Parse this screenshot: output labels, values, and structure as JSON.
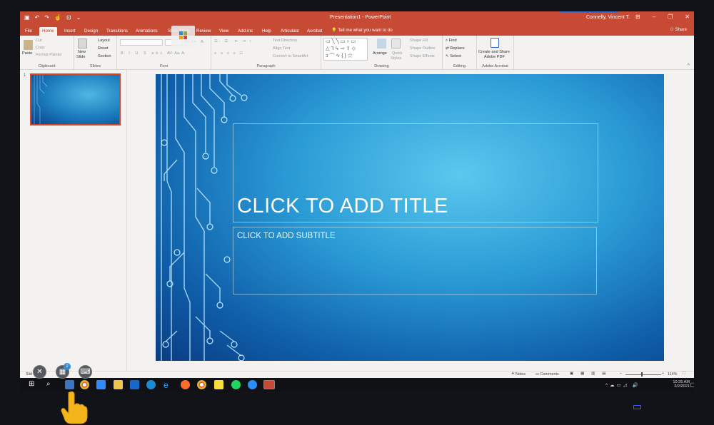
{
  "titlebar": {
    "document_title": "Presentation1 - PowerPoint",
    "user": "Connelly, Vincent T.",
    "qat": [
      "save-icon",
      "undo-icon",
      "redo-icon",
      "touch-mode-icon",
      "present-icon",
      "more-icon"
    ]
  },
  "tabs": [
    "File",
    "Home",
    "Insert",
    "Design",
    "Transitions",
    "Animations",
    "Slide Show",
    "Review",
    "View",
    "Add-ins",
    "Help",
    "Articulate",
    "Acrobat"
  ],
  "tell_me": "Tell me what you want to do",
  "share": "Share",
  "ribbon": {
    "clipboard": {
      "label": "Clipboard",
      "paste": "Paste",
      "cut": "Cut",
      "copy": "Copy",
      "format_painter": "Format Painter"
    },
    "slides": {
      "label": "Slides",
      "new_slide": "New",
      "new_slide2": "Slide",
      "layout": "Layout",
      "reset": "Reset",
      "section": "Section"
    },
    "font": {
      "label": "Font"
    },
    "paragraph": {
      "label": "Paragraph",
      "text_direction": "Text Direction",
      "align_text": "Align Text",
      "smartart": "Convert to SmartArt"
    },
    "drawing": {
      "label": "Drawing",
      "arrange": "Arrange",
      "quick_styles": "Quick",
      "quick_styles2": "Styles",
      "shape_fill": "Shape Fill",
      "shape_outline": "Shape Outline",
      "shape_effects": "Shape Effects"
    },
    "editing": {
      "label": "Editing",
      "find": "Find",
      "replace": "Replace",
      "select": "Select"
    },
    "adobe": {
      "label": "Adobe Acrobat",
      "create": "Create and Share",
      "create2": "Adobe PDF"
    }
  },
  "thumbnail": {
    "number": "1"
  },
  "slide": {
    "title": "CLICK TO ADD TITLE",
    "subtitle": "CLICK TO ADD SUBTITLE"
  },
  "statusbar": {
    "slide": "Slid",
    "notes": "Notes",
    "comments": "Comments",
    "zoom": "114%"
  },
  "taskbar": {
    "time": "10:35 AM",
    "date": "2/2/2021"
  },
  "overlay": {
    "badge": "2"
  },
  "colors": {
    "accent": "#c64a34",
    "slide_dark": "#0a3c82",
    "slide_light": "#5bc8ee"
  }
}
